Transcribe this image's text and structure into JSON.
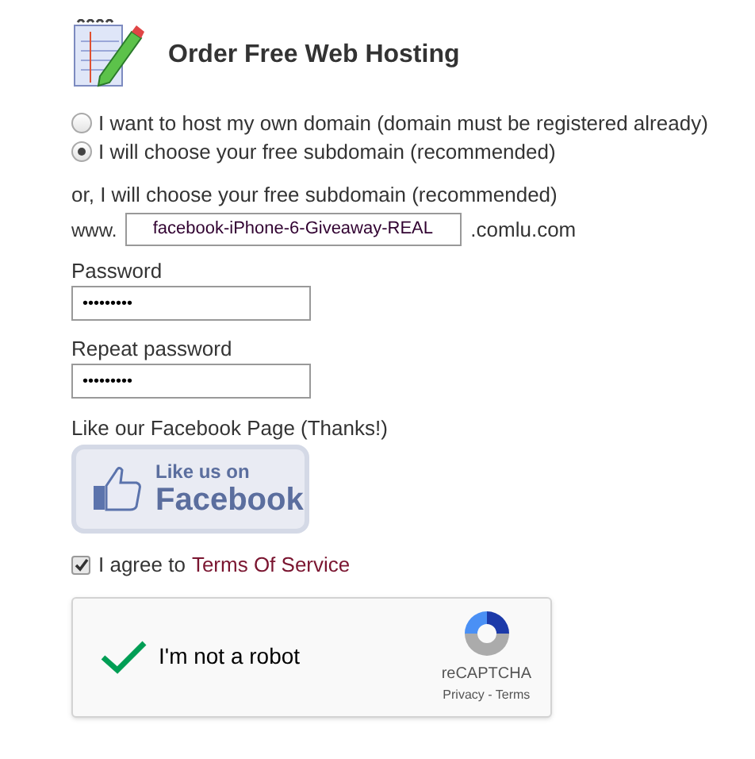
{
  "title": "Order Free Web Hosting",
  "domain_options": [
    {
      "label": "I want to host my own domain (domain must be registered already)",
      "selected": false
    },
    {
      "label": "I will choose your free subdomain (recommended)",
      "selected": true
    }
  ],
  "subdomain": {
    "label": "or, I will choose your free subdomain (recommended)",
    "prefix": "www.",
    "value": "facebook-iPhone-6-Giveaway-REAL",
    "suffix": ".comlu.com"
  },
  "password": {
    "label": "Password",
    "value": "•••••••••"
  },
  "repeat_password": {
    "label": "Repeat password",
    "value": "•••••••••"
  },
  "facebook": {
    "label": "Like our Facebook Page (Thanks!)",
    "button_line_1": "Like us on",
    "button_line_2": "Facebook"
  },
  "terms": {
    "checked": true,
    "text": "I agree to",
    "link": "Terms Of Service"
  },
  "captcha": {
    "checked": true,
    "label": "I'm not a robot",
    "brand": "reCAPTCHA",
    "links": "Privacy - Terms"
  }
}
